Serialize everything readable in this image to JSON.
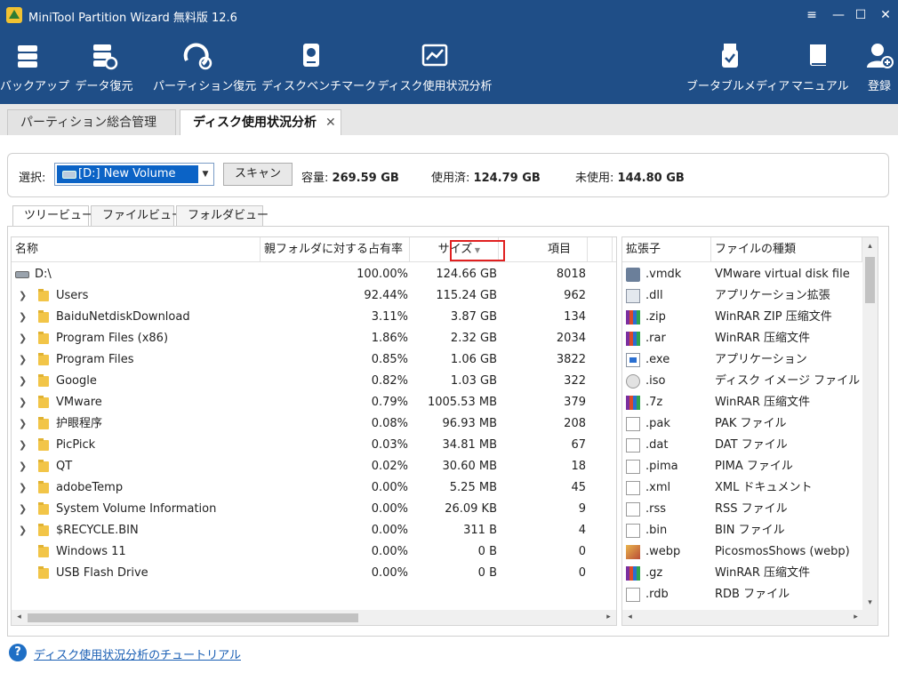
{
  "window": {
    "title": "MiniTool Partition Wizard 無料版 12.6",
    "controls": [
      "≡",
      "—",
      "☐",
      "✕"
    ]
  },
  "toolbar": [
    {
      "label": "バックアップ",
      "icon": "backup-icon"
    },
    {
      "label": "データ復元",
      "icon": "data-recovery-icon"
    },
    {
      "label": "パーティション復元",
      "icon": "partition-recovery-icon"
    },
    {
      "label": "ディスクベンチマーク",
      "icon": "disk-benchmark-icon"
    },
    {
      "label": "ディスク使用状況分析",
      "icon": "space-analyzer-icon"
    },
    {
      "label": "ブータブルメディア",
      "icon": "bootable-media-icon"
    },
    {
      "label": "マニュアル",
      "icon": "manual-icon"
    },
    {
      "label": "登録",
      "icon": "register-icon"
    }
  ],
  "tabs": [
    {
      "label": "パーティション総合管理"
    },
    {
      "label": "ディスク使用状況分析",
      "close": "✕"
    }
  ],
  "selection": {
    "label": "選択:",
    "drive": "[D:] New Volume",
    "scan": "スキャン",
    "capacity_label": "容量:",
    "capacity": "269.59 GB",
    "used_label": "使用済:",
    "used": "124.79 GB",
    "free_label": "未使用:",
    "free": "144.80 GB"
  },
  "view_tabs": [
    "ツリービュー",
    "ファイルビュー",
    "フォルダビュー"
  ],
  "tree": {
    "columns": [
      "名称",
      "親フォルダに対する占有率",
      "サイズ",
      "項目"
    ],
    "rows": [
      {
        "name": "D:\\",
        "pct": "100.00%",
        "size": "124.66 GB",
        "items": "8018",
        "type": "drive"
      },
      {
        "name": "Users",
        "pct": "92.44%",
        "size": "115.24 GB",
        "items": "962",
        "type": "folder",
        "expand": "❯"
      },
      {
        "name": "BaiduNetdiskDownload",
        "pct": "3.11%",
        "size": "3.87 GB",
        "items": "134",
        "type": "folder",
        "expand": "❯"
      },
      {
        "name": "Program Files (x86)",
        "pct": "1.86%",
        "size": "2.32 GB",
        "items": "2034",
        "type": "folder",
        "expand": "❯"
      },
      {
        "name": "Program Files",
        "pct": "0.85%",
        "size": "1.06 GB",
        "items": "3822",
        "type": "folder",
        "expand": "❯"
      },
      {
        "name": "Google",
        "pct": "0.82%",
        "size": "1.03 GB",
        "items": "322",
        "type": "folder",
        "expand": "❯"
      },
      {
        "name": "VMware",
        "pct": "0.79%",
        "size": "1005.53 MB",
        "items": "379",
        "type": "folder",
        "expand": "❯"
      },
      {
        "name": "护眼程序",
        "pct": "0.08%",
        "size": "96.93 MB",
        "items": "208",
        "type": "folder",
        "expand": "❯"
      },
      {
        "name": "PicPick",
        "pct": "0.03%",
        "size": "34.81 MB",
        "items": "67",
        "type": "folder",
        "expand": "❯"
      },
      {
        "name": "QT",
        "pct": "0.02%",
        "size": "30.60 MB",
        "items": "18",
        "type": "folder",
        "expand": "❯"
      },
      {
        "name": "adobeTemp",
        "pct": "0.00%",
        "size": "5.25 MB",
        "items": "45",
        "type": "folder",
        "expand": "❯"
      },
      {
        "name": "System Volume Information",
        "pct": "0.00%",
        "size": "26.09 KB",
        "items": "9",
        "type": "folder",
        "expand": "❯"
      },
      {
        "name": "$RECYCLE.BIN",
        "pct": "0.00%",
        "size": "311 B",
        "items": "4",
        "type": "folder",
        "expand": "❯"
      },
      {
        "name": "Windows 11",
        "pct": "0.00%",
        "size": "0 B",
        "items": "0",
        "type": "folder",
        "expand": ""
      },
      {
        "name": "USB Flash Drive",
        "pct": "0.00%",
        "size": "0 B",
        "items": "0",
        "type": "folder",
        "expand": ""
      }
    ]
  },
  "extensions": {
    "columns": [
      "拡張子",
      "ファイルの種類"
    ],
    "rows": [
      {
        "ext": ".vmdk",
        "type": "VMware virtual disk file",
        "icon": "vmdk"
      },
      {
        "ext": ".dll",
        "type": "アプリケーション拡張",
        "icon": "dll"
      },
      {
        "ext": ".zip",
        "type": "WinRAR ZIP 压缩文件",
        "icon": "rar"
      },
      {
        "ext": ".rar",
        "type": "WinRAR 压缩文件",
        "icon": "rar"
      },
      {
        "ext": ".exe",
        "type": "アプリケーション",
        "icon": "exe"
      },
      {
        "ext": ".iso",
        "type": "ディスク イメージ ファイル",
        "icon": "iso"
      },
      {
        "ext": ".7z",
        "type": "WinRAR 压缩文件",
        "icon": "rar"
      },
      {
        "ext": ".pak",
        "type": "PAK ファイル",
        "icon": "file"
      },
      {
        "ext": ".dat",
        "type": "DAT ファイル",
        "icon": "file"
      },
      {
        "ext": ".pima",
        "type": "PIMA ファイル",
        "icon": "file"
      },
      {
        "ext": ".xml",
        "type": "XML ドキュメント",
        "icon": "file"
      },
      {
        "ext": ".rss",
        "type": "RSS ファイル",
        "icon": "file"
      },
      {
        "ext": ".bin",
        "type": "BIN ファイル",
        "icon": "file"
      },
      {
        "ext": ".webp",
        "type": "PicosmosShows (webp)",
        "icon": "webp"
      },
      {
        "ext": ".gz",
        "type": "WinRAR 压缩文件",
        "icon": "rar"
      },
      {
        "ext": ".rdb",
        "type": "RDB ファイル",
        "icon": "file"
      }
    ]
  },
  "scroll": {
    "left": "◂",
    "right": "▸",
    "up": "▴",
    "down": "▾"
  },
  "footer": {
    "help_glyph": "?",
    "link": "ディスク使用状況分析のチュートリアル"
  },
  "colors": {
    "header": "#1f4e87",
    "selection": "#0b63c6",
    "sort_highlight": "#e02020",
    "link": "#1a5fb4"
  }
}
